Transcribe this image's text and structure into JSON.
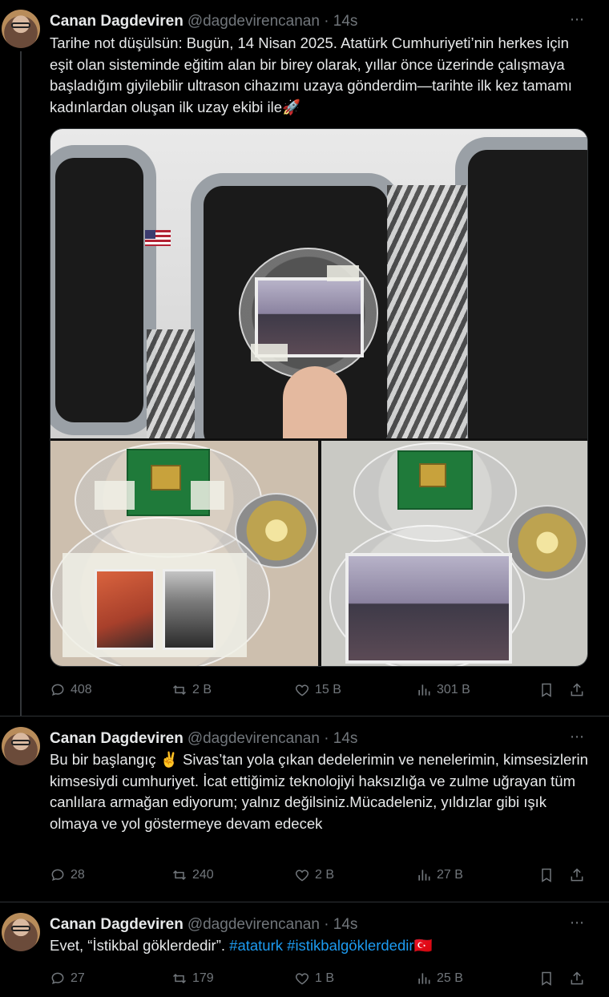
{
  "tweets": [
    {
      "name": "Canan Dagdeviren",
      "handle": "@dagdevirencanan",
      "time": "· 14s",
      "text": "Tarihe not düşülsün: Bugün, 14 Nisan 2025. Atatürk Cumhuriyeti’nin herkes için eşit olan sisteminde eğitim alan bir birey olarak, yıllar önce üzerinde çalışmaya başladığım giyilebilir ultrason cihazımı uzaya gönderdim—tarihte ilk kez tamamı kadınlardan oluşan ilk uzay ekibi ile🚀",
      "replies": "408",
      "retweets": "2 B",
      "likes": "15 B",
      "views": "301 B"
    },
    {
      "name": "Canan Dagdeviren",
      "handle": "@dagdevirencanan",
      "time": "· 14s",
      "text": "Bu bir başlangıç ✌️ Sivas’tan yola çıkan dedelerimin ve nenelerimin, kimsesizlerin kimsesiydi cumhuriyet. İcat ettiğimiz teknolojiyi haksızlığa ve zulme uğrayan tüm canlılara armağan ediyorum; yalnız değilsiniz.Mücadeleniz, yıldızlar gibi ışık olmaya ve yol göstermeye devam edecek",
      "replies": "28",
      "retweets": "240",
      "likes": "2 B",
      "views": "27 B"
    },
    {
      "name": "Canan Dagdeviren",
      "handle": "@dagdevirencanan",
      "time": "· 14s",
      "text_prefix": "Evet, “İstikbal göklerdedir”.",
      "hashtag1": "#ataturk",
      "hashtag2": "#istikbalgöklerdedir",
      "text_suffix": "🇹🇷",
      "replies": "27",
      "retweets": "179",
      "likes": "1 B",
      "views": "25 B"
    }
  ],
  "icons": {
    "more": "⋯",
    "reply": "reply-icon",
    "retweet": "retweet-icon",
    "like": "heart-icon",
    "views": "views-icon",
    "bookmark": "bookmark-icon",
    "share": "share-icon"
  },
  "colors": {
    "background": "#000000",
    "text": "#e7e9ea",
    "muted": "#71767b",
    "link": "#1d9bf0",
    "divider": "#2f3336"
  }
}
